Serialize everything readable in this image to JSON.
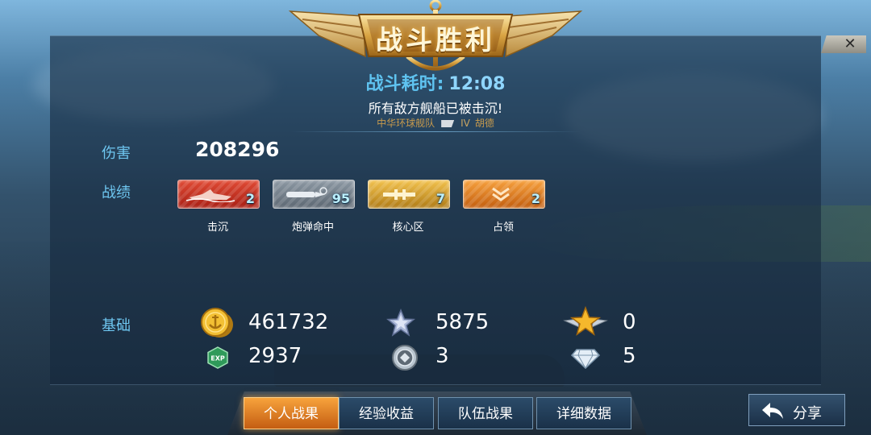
{
  "header": {
    "title": "战斗胜利",
    "close_label": "✕"
  },
  "summary": {
    "time_label": "战斗耗时:",
    "time_value": "12:08",
    "result": "所有敌方舰船已被击沉!",
    "fleet_name": "中华环球舰队",
    "rank": "IV",
    "player": "胡德"
  },
  "damage": {
    "label": "伤害",
    "value": "208296"
  },
  "achievements": {
    "label": "战绩",
    "items": [
      {
        "caption": "击沉",
        "count": "2",
        "icon": "sunk-ship-icon",
        "color": "#d9392a"
      },
      {
        "caption": "炮弹命中",
        "count": "95",
        "icon": "shell-hit-icon",
        "color": "#7d8995"
      },
      {
        "caption": "核心区",
        "count": "7",
        "icon": "core-hit-icon",
        "color": "#e3ad34"
      },
      {
        "caption": "占领",
        "count": "2",
        "icon": "capture-chevron-icon",
        "color": "#ee8a2a"
      }
    ]
  },
  "basics": {
    "label": "基础",
    "row1": [
      {
        "icon": "gold-anchor-coin-icon",
        "value": "461732"
      },
      {
        "icon": "silver-star-icon",
        "value": "5875"
      },
      {
        "icon": "winged-gold-star-icon",
        "value": "0"
      }
    ],
    "row2": [
      {
        "icon": "exp-badge-icon",
        "icon_text": "EXP",
        "value": "2937"
      },
      {
        "icon": "silver-medal-icon",
        "value": "3"
      },
      {
        "icon": "diamond-icon",
        "value": "5"
      }
    ]
  },
  "tabs": [
    {
      "label": "个人战果",
      "active": true
    },
    {
      "label": "经验收益",
      "active": false
    },
    {
      "label": "队伍战果",
      "active": false
    },
    {
      "label": "详细数据",
      "active": false
    }
  ],
  "share": {
    "label": "分享",
    "icon": "share-arrow-icon"
  }
}
